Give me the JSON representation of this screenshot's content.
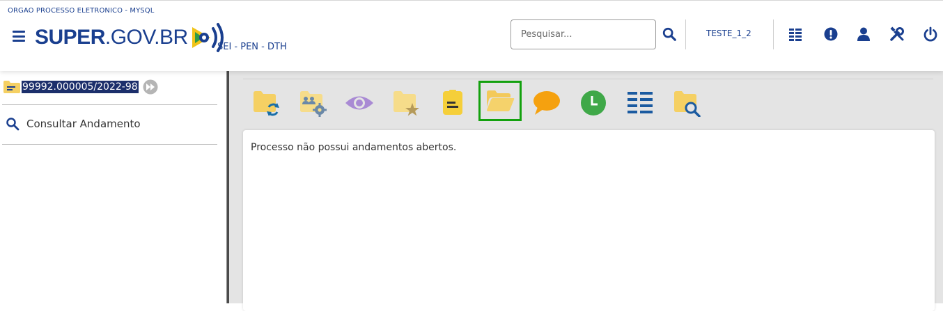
{
  "header": {
    "org_name": "ORGAO PROCESSO ELETRONICO - MYSQL",
    "logo_text_bold": "SUPER",
    "logo_text_rest": ".GOV.BR",
    "system_name": "SEI - PEN - DTH",
    "search_placeholder": "Pesquisar...",
    "user_unit": "TESTE_1_2",
    "icons": [
      "menu-icon",
      "search-icon",
      "list-icon",
      "alert-icon",
      "user-icon",
      "tools-icon",
      "power-icon"
    ]
  },
  "left_panel": {
    "process_number": "99992.000005/2022-98",
    "consult_label": "Consultar Andamento"
  },
  "toolbar": {
    "buttons": [
      "folder-sync-icon",
      "group-settings-icon",
      "eye-icon",
      "folder-star-icon",
      "note-icon",
      "folder-open-icon",
      "comment-icon",
      "clock-icon",
      "list-lines-icon",
      "folder-search-icon"
    ],
    "active_button": "folder-open-icon"
  },
  "content": {
    "message": "Processo não possui andamentos abertos."
  },
  "colors": {
    "brand_blue": "#1a3f8f",
    "folder_yellow": "#f5d063",
    "active_border": "#13a10e"
  }
}
